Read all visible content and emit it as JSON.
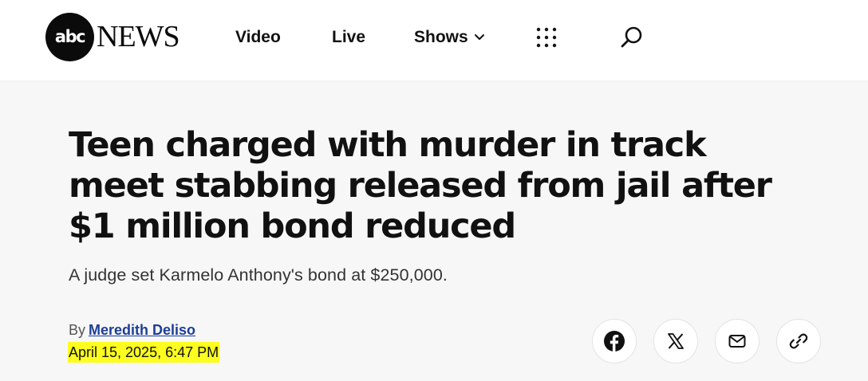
{
  "header": {
    "logo": {
      "circle_text": "abc",
      "wordmark": "NEWS"
    },
    "nav": [
      {
        "label": "Video"
      },
      {
        "label": "Live"
      },
      {
        "label": "Shows"
      }
    ],
    "icons": {
      "more": "grid-dots-icon",
      "search": "search-icon"
    }
  },
  "article": {
    "headline": "Teen charged with murder in track meet stabbing released from jail after $1 million bond reduced",
    "subheadline": "A judge set Karmelo Anthony's bond at $250,000.",
    "byline_prefix": "By",
    "author": "Meredith Deliso",
    "timestamp": "April 15, 2025, 6:47 PM"
  },
  "share": [
    {
      "icon": "facebook-icon"
    },
    {
      "icon": "x-icon"
    },
    {
      "icon": "email-icon"
    },
    {
      "icon": "link-icon"
    }
  ],
  "colors": {
    "highlight": "#fdfd1f",
    "author_link": "#1d3e97",
    "header_bg": "#ffffff",
    "page_bg": "#f7f7f7"
  }
}
